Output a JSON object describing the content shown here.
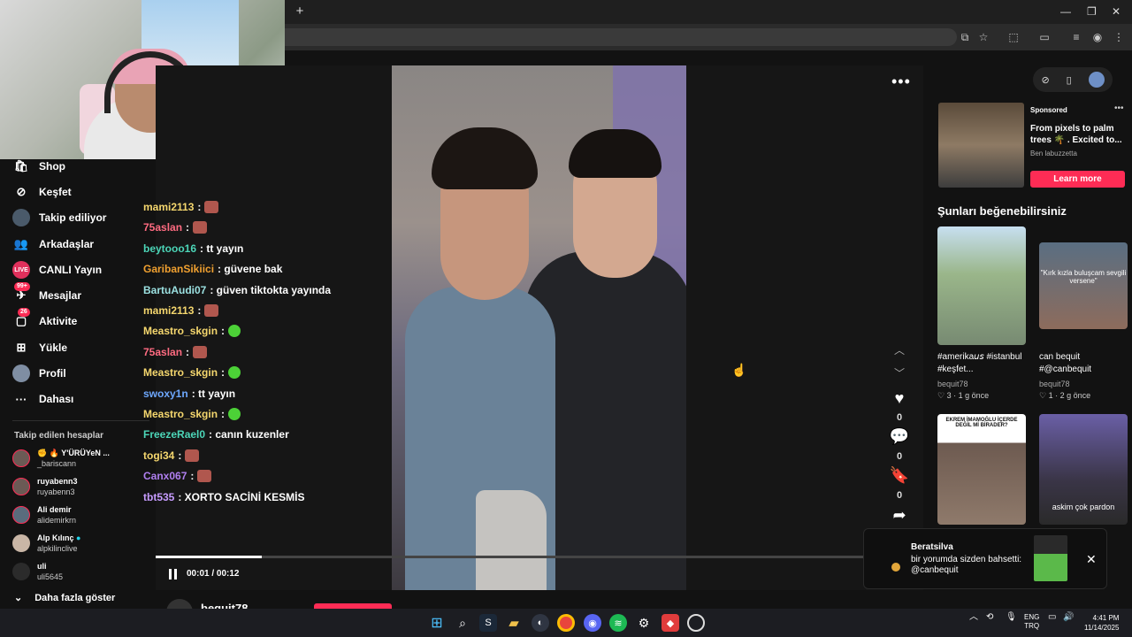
{
  "sidebar": {
    "items": [
      {
        "label": "Shop",
        "icon": "shop-icon"
      },
      {
        "label": "Keşfet",
        "icon": "compass-icon"
      },
      {
        "label": "Takip ediliyor",
        "icon": "following-icon"
      },
      {
        "label": "Arkadaşlar",
        "icon": "friends-icon"
      },
      {
        "label": "CANLI Yayın",
        "icon": "live-icon"
      },
      {
        "label": "Mesajlar",
        "icon": "messages-icon",
        "badge": "99+"
      },
      {
        "label": "Aktivite",
        "icon": "activity-icon",
        "badge": "26"
      },
      {
        "label": "Yükle",
        "icon": "upload-icon"
      },
      {
        "label": "Profil",
        "icon": "profile-icon"
      },
      {
        "label": "Dahası",
        "icon": "more-icon"
      }
    ],
    "following_title": "Takip edilen hesaplar",
    "following": [
      {
        "name": "✊ 🔥 Y'ÜRÜYeN ...",
        "handle": "_bariscann"
      },
      {
        "name": "ruyabenn3",
        "handle": "ruyabenn3"
      },
      {
        "name": "Ali demir",
        "handle": "alidemirkrn"
      },
      {
        "name": "Alp Kılınç",
        "handle": "alpkilinclive"
      },
      {
        "name": "uli",
        "handle": "uli5645"
      }
    ],
    "show_more": "Daha fazla göster"
  },
  "chat": [
    {
      "user": "mami2113",
      "msg": ":",
      "emote": "red",
      "color": "#f5d76e"
    },
    {
      "user": "75aslan",
      "msg": ":",
      "emote": "red",
      "color": "#ff6b81"
    },
    {
      "user": "beytooo16",
      "msg": ": tt yayın",
      "emote": "",
      "color": "#4cd6b8"
    },
    {
      "user": "GaribanSikiici",
      "msg": ": güvene bak",
      "emote": "",
      "color": "#f0a030"
    },
    {
      "user": "BartuAudi07",
      "msg": ": güven tiktokta yayında",
      "emote": "",
      "color": "#9be0e0"
    },
    {
      "user": "mami2113",
      "msg": ":",
      "emote": "red",
      "color": "#f5d76e"
    },
    {
      "user": "Meastro_skgin",
      "msg": ":",
      "emote": "green",
      "color": "#f5d76e"
    },
    {
      "user": "75aslan",
      "msg": ":",
      "emote": "red",
      "color": "#ff6b81"
    },
    {
      "user": "Meastro_skgin",
      "msg": ":",
      "emote": "green",
      "color": "#f5d76e"
    },
    {
      "user": "swoxy1n",
      "msg": ": tt yayın",
      "emote": "",
      "color": "#6ea8fe"
    },
    {
      "user": "Meastro_skgin",
      "msg": ":",
      "emote": "green",
      "color": "#f5d76e"
    },
    {
      "user": "FreezeRael0",
      "msg": ": canın kuzenler",
      "emote": "",
      "color": "#4cd6b8"
    },
    {
      "user": "togi34",
      "msg": ":",
      "emote": "red",
      "color": "#f5d76e"
    },
    {
      "user": "Canx067",
      "msg": ":",
      "emote": "red",
      "color": "#b07ff0"
    },
    {
      "user": "tbt535",
      "msg": ": XORTO SACİNİ KESMİS",
      "emote": "",
      "color": "#c79cff"
    }
  ],
  "video": {
    "time": "00:01 / 00:12",
    "progress_pct": 15,
    "likes": "0",
    "comments": "0",
    "saves": "0",
    "author": "bequit78"
  },
  "ad": {
    "sponsored": "Sponsored",
    "title": "From pixels to palm trees 🌴 . Excited to...",
    "author": "Ben labuzzetta",
    "cta": "Learn more"
  },
  "recommend": {
    "title": "Şunları beğenebilirsiniz",
    "items": [
      {
        "caption": "#amerika𝘶𝘴 #istanbul #keşfet...",
        "author": "bequit78",
        "stats": "♡ 3 · 1 g önce"
      },
      {
        "caption": "can bequit #@canbequit",
        "author": "bequit78",
        "stats": "♡ 1 · 2 g önce",
        "overlay": "\"Kırk kızla buluşcam sevgili versene\""
      },
      {
        "caption": "",
        "author": "",
        "stats": "",
        "overlay": "EKREM İMAMOĞLU İÇERDE DEĞİL Mİ BİRADER?"
      },
      {
        "caption": "",
        "author": "",
        "stats": "",
        "overlay": "askim çok pardon"
      }
    ]
  },
  "notification": {
    "name": "Beratsilva",
    "text": "bir yorumda sizden bahsetti:",
    "mention": "@canbequit"
  },
  "taskbar": {
    "lang1": "ENG",
    "lang2": "TRQ",
    "time": "4:41 PM",
    "date": "11/14/2025"
  },
  "colors": {
    "accent": "#fe2c55",
    "bg": "#121212"
  }
}
